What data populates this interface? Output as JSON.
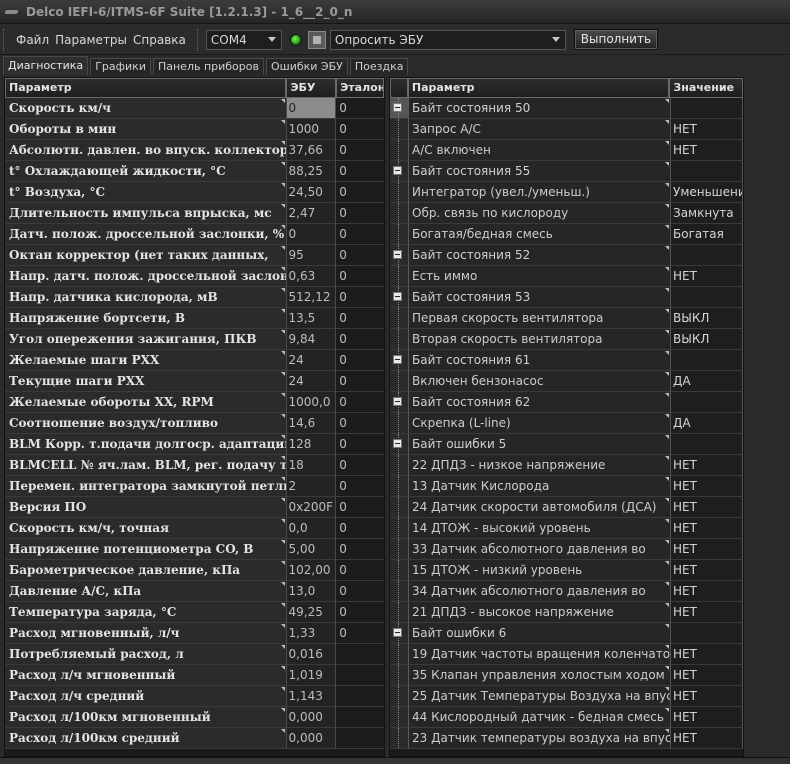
{
  "window": {
    "title": "Delco IEFI-6/ITMS-6F Suite [1.2.1.3] - 1_6__2_0_n"
  },
  "menu": {
    "file": "Файл",
    "params": "Параметры",
    "help": "Справка"
  },
  "toolbar": {
    "port": "COM4",
    "ecu_query": "Опросить ЭБУ",
    "run_label": "Выполнить"
  },
  "tabs": [
    "Диагностика",
    "Графики",
    "Панель приборов",
    "Ошибки ЭБУ",
    "Поездка"
  ],
  "left_table": {
    "headers": {
      "param": "Параметр",
      "ecu": "ЭБУ",
      "ref": "Эталон"
    },
    "rows": [
      {
        "param": "Скорость км/ч",
        "ecu": "0",
        "ref": "0"
      },
      {
        "param": "Обороты в мин",
        "ecu": "1000",
        "ref": "0"
      },
      {
        "param": "Абсолютн. давлен. во впуск. коллекторе, кПа",
        "ecu": "37,66",
        "ref": "0"
      },
      {
        "param": "t° Охлаждающей жидкости, °C",
        "ecu": "88,25",
        "ref": "0"
      },
      {
        "param": "t° Воздуха, °C",
        "ecu": "24,50",
        "ref": "0"
      },
      {
        "param": "Длительность импульса впрыска, мс",
        "ecu": "2,47",
        "ref": "0"
      },
      {
        "param": "Датч. полож. дроссельной заслонки, %",
        "ecu": "0",
        "ref": "0"
      },
      {
        "param": "Октан корректор (нет таких данных,",
        "ecu": "95",
        "ref": "0"
      },
      {
        "param": "Напр. датч. полож. дроссельной заслонки, В",
        "ecu": "0,63",
        "ref": "0"
      },
      {
        "param": "Напр. датчика кислорода, мВ",
        "ecu": "512,12",
        "ref": "0"
      },
      {
        "param": "Напряжение бортсети, В",
        "ecu": "13,5",
        "ref": "0"
      },
      {
        "param": "Угол опережения зажигания, ПКВ",
        "ecu": "9,84",
        "ref": "0"
      },
      {
        "param": "Желаемые шаги РХХ",
        "ecu": "24",
        "ref": "0"
      },
      {
        "param": "Текущие шаги РХХ",
        "ecu": "24",
        "ref": "0"
      },
      {
        "param": "Желаемые обороты ХХ, RPM",
        "ecu": "1000,0",
        "ref": "0"
      },
      {
        "param": "Соотношение воздух/топливо",
        "ecu": "14,6",
        "ref": "0"
      },
      {
        "param": "BLM Корр. т.подачи долгоср. адаптации",
        "ecu": "128",
        "ref": "0"
      },
      {
        "param": "BLMCELL № яч.лам. BLM, рег. подачу топлива",
        "ecu": "18",
        "ref": "0"
      },
      {
        "param": "Перемен. интегратора замкнутой петли топл.",
        "ecu": "2",
        "ref": "0"
      },
      {
        "param": "Версия ПО",
        "ecu": "0x200F",
        "ref": "0"
      },
      {
        "param": "Скорость км/ч, точная",
        "ecu": "0,0",
        "ref": "0"
      },
      {
        "param": "Напряжение потенциометра CO, В",
        "ecu": "5,00",
        "ref": "0"
      },
      {
        "param": "Барометрическое давление, кПа",
        "ecu": "102,00",
        "ref": "0"
      },
      {
        "param": "Давление А/С, кПа",
        "ecu": "13,0",
        "ref": "0"
      },
      {
        "param": "Температура заряда, °C",
        "ecu": "49,25",
        "ref": "0"
      },
      {
        "param": "Расход мгновенный, л/ч",
        "ecu": "1,33",
        "ref": "0"
      },
      {
        "param": "Потребляемый расход, л",
        "ecu": "0,016",
        "ref": ""
      },
      {
        "param": "Расход л/ч мгновенный",
        "ecu": "1,019",
        "ref": ""
      },
      {
        "param": "Расход л/ч средний",
        "ecu": "1,143",
        "ref": ""
      },
      {
        "param": "Расход л/100км мгновенный",
        "ecu": "0,000",
        "ref": ""
      },
      {
        "param": "Расход л/100км средний",
        "ecu": "0,000",
        "ref": ""
      }
    ]
  },
  "right_table": {
    "headers": {
      "param": "Параметр",
      "value": "Значение"
    },
    "rows": [
      {
        "group": true,
        "param": "Байт состояния 50",
        "value": ""
      },
      {
        "group": false,
        "param": "Запрос А/С",
        "value": "НЕТ"
      },
      {
        "group": false,
        "param": "А/С включен",
        "value": "НЕТ"
      },
      {
        "group": true,
        "param": "Байт состояния 55",
        "value": ""
      },
      {
        "group": false,
        "param": "Интегратор (увел./уменьш.)",
        "value": "Уменьшени"
      },
      {
        "group": false,
        "param": "Обр. связь по кислороду",
        "value": "Замкнута"
      },
      {
        "group": false,
        "param": "Богатая/бедная смесь",
        "value": "Богатая"
      },
      {
        "group": true,
        "param": "Байт состояния 52",
        "value": ""
      },
      {
        "group": false,
        "param": "Есть иммо",
        "value": "НЕТ"
      },
      {
        "group": true,
        "param": "Байт состояния 53",
        "value": ""
      },
      {
        "group": false,
        "param": "Первая скорость вентилятора",
        "value": "ВЫКЛ"
      },
      {
        "group": false,
        "param": "Вторая скорость вентилятора",
        "value": "ВЫКЛ"
      },
      {
        "group": true,
        "param": "Байт состояния 61",
        "value": ""
      },
      {
        "group": false,
        "param": "Включен бензонасос",
        "value": "ДА"
      },
      {
        "group": true,
        "param": "Байт состояния 62",
        "value": ""
      },
      {
        "group": false,
        "param": "Скрепка (L-line)",
        "value": "ДА"
      },
      {
        "group": true,
        "param": "Байт ошибки 5",
        "value": ""
      },
      {
        "group": false,
        "param": "22 ДПДЗ - низкое напряжение",
        "value": "НЕТ"
      },
      {
        "group": false,
        "param": "13 Датчик Кислорода",
        "value": "НЕТ"
      },
      {
        "group": false,
        "param": "24 Датчик скорости автомобиля (ДСА)",
        "value": "НЕТ"
      },
      {
        "group": false,
        "param": "14 ДТОЖ - высокий уровень",
        "value": "НЕТ"
      },
      {
        "group": false,
        "param": "33 Датчик абсолютного давления во",
        "value": "НЕТ"
      },
      {
        "group": false,
        "param": "15 ДТОЖ - низкий уровень",
        "value": "НЕТ"
      },
      {
        "group": false,
        "param": "34 Датчик абсолютного давления во",
        "value": "НЕТ"
      },
      {
        "group": false,
        "param": "21 ДПДЗ - высокое напряжение",
        "value": "НЕТ"
      },
      {
        "group": true,
        "param": "Байт ошибки 6",
        "value": ""
      },
      {
        "group": false,
        "param": "19 Датчик частоты вращения коленчатого",
        "value": "НЕТ"
      },
      {
        "group": false,
        "param": "35 Клапан управления холостым ходом",
        "value": "НЕТ"
      },
      {
        "group": false,
        "param": "25 Датчик Температуры Воздуха на впуске",
        "value": "НЕТ"
      },
      {
        "group": false,
        "param": "44 Кислородный датчик - бедная смесь",
        "value": "НЕТ"
      },
      {
        "group": false,
        "param": "23 Датчик температуры воздуха на впуске",
        "value": "НЕТ"
      }
    ]
  }
}
